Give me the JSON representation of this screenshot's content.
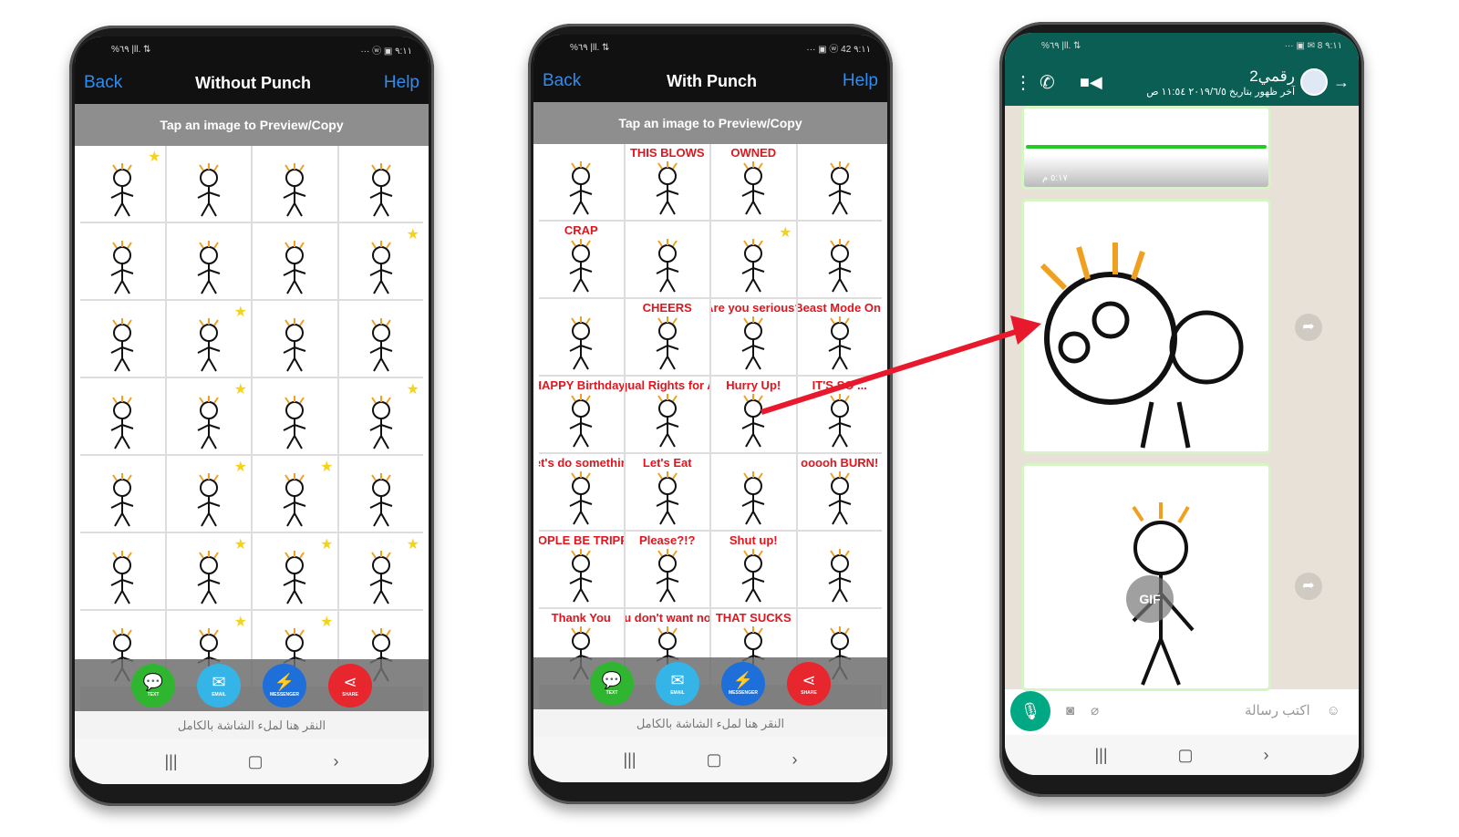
{
  "phones": [
    {
      "status_left": "%٦٩ |ll. ⇅",
      "status_right": "··· ⓦ ▣ ٩:١١",
      "back": "Back",
      "title": "Without Punch",
      "help": "Help",
      "tap_hint": "Tap an image to Preview/Copy",
      "captions": [
        "",
        "",
        "",
        "",
        "",
        "",
        "",
        "",
        "",
        "",
        "",
        "",
        "",
        "",
        "",
        "",
        "",
        "",
        "",
        "",
        "",
        "",
        "",
        "",
        "",
        "",
        "",
        ""
      ],
      "stars": [
        0,
        7,
        9,
        13,
        15,
        17,
        18,
        21,
        22,
        23,
        25,
        26
      ]
    },
    {
      "status_left": "%٦٩ |ll. ⇅",
      "status_right": "··· ▣ ⓦ 42 ٩:١١",
      "back": "Back",
      "title": "With Punch",
      "help": "Help",
      "tap_hint": "Tap an image to Preview/Copy",
      "captions": [
        "",
        "THIS BLOWS",
        "OWNED",
        "",
        "CRAP",
        "",
        "",
        "",
        "",
        "CHEERS",
        "Are you serious?",
        "Beast Mode On!",
        "HAPPY Birthday!",
        "Equal Rights for All",
        "Hurry Up!",
        "IT'S SO ...",
        "Let's do something",
        "Let's Eat",
        "",
        "ooooh BURN!",
        "PEOPLE BE TRIPPIN",
        "Please?!?",
        "Shut up!",
        "",
        "Thank You",
        "You don't want none",
        "THAT SUCKS",
        ""
      ],
      "stars": [
        6
      ]
    }
  ],
  "actions": [
    {
      "label": "TEXT",
      "icon": "chat-bubble-icon",
      "color": "#2fb52f"
    },
    {
      "label": "EMAIL",
      "icon": "envelope-icon",
      "color": "#35b4e8"
    },
    {
      "label": "MESSENGER",
      "icon": "messenger-icon",
      "color": "#1e6fd9"
    },
    {
      "label": "SHARE",
      "icon": "share-icon",
      "color": "#e8262d"
    }
  ],
  "fullscreen_hint": "النقر هنا لملء الشاشة بالكامل",
  "whatsapp": {
    "status_left": "%٦٩ |ll. ⇅",
    "status_right": "··· ▣ ✉ 8 ٩:١١",
    "contact": "رقمي2",
    "last_seen": "آخر ظهور بتاريخ ٢٠١٩/٦/٥ ١١:٥٤ ص",
    "msg_time": "٥:١٧ م",
    "gif_label": "GIF",
    "input_placeholder": "اكتب رسالة",
    "colors": {
      "header": "#0a5e54",
      "accent": "#00a884"
    }
  },
  "annotation": {
    "arrow_color": "#e8192c"
  }
}
